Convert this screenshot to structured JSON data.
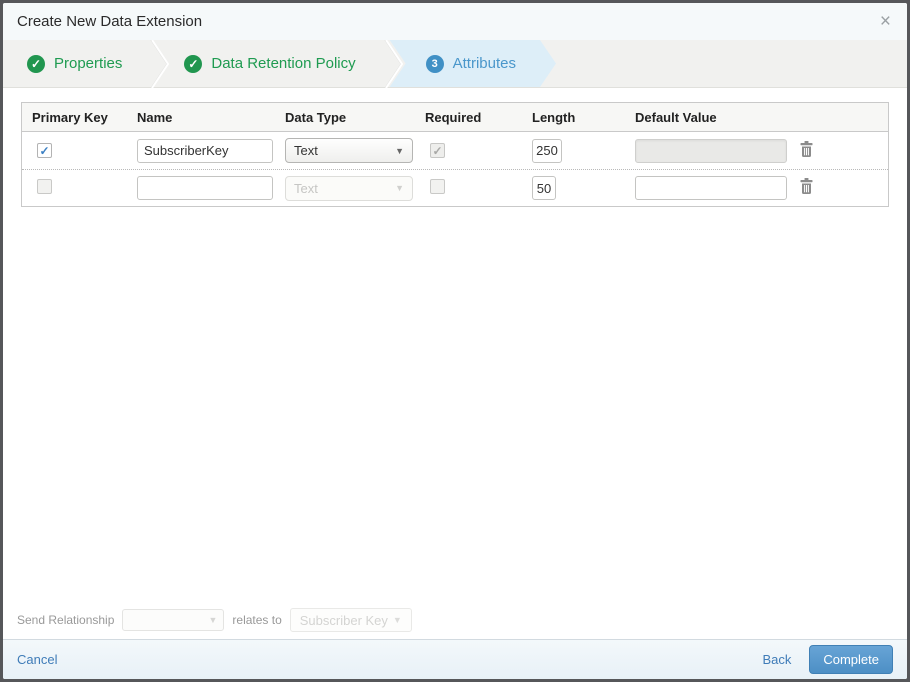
{
  "dialog": {
    "title": "Create New Data Extension"
  },
  "icons": {
    "close": "×",
    "check": "✓",
    "caret": "▼"
  },
  "steps": [
    {
      "label": "Properties",
      "status": "complete"
    },
    {
      "label": "Data Retention Policy",
      "status": "complete"
    },
    {
      "label": "Attributes",
      "status": "current",
      "number": "3"
    }
  ],
  "table": {
    "headers": {
      "primary_key": "Primary Key",
      "name": "Name",
      "data_type": "Data Type",
      "required": "Required",
      "length": "Length",
      "default_value": "Default Value"
    },
    "rows": [
      {
        "primary_key": true,
        "name": "SubscriberKey",
        "data_type": "Text",
        "data_type_enabled": true,
        "required": true,
        "required_enabled": false,
        "length": "250",
        "default_value": "",
        "default_value_enabled": false
      },
      {
        "primary_key": false,
        "name": "",
        "data_type": "Text",
        "data_type_enabled": false,
        "required": false,
        "required_enabled": true,
        "length": "50",
        "default_value": "",
        "default_value_enabled": true
      }
    ]
  },
  "send_relationship": {
    "label": "Send Relationship",
    "relates_label": "relates to",
    "target_value": "Subscriber Key"
  },
  "footer": {
    "cancel": "Cancel",
    "back": "Back",
    "complete": "Complete"
  },
  "colors": {
    "step_complete_green": "#21964f",
    "step_current_blue": "#4090c5",
    "step_current_bg": "#ddeef8",
    "link_blue": "#3f7cb8",
    "complete_button_blue": "#4d8fc5",
    "dialog_border": "#56575a"
  }
}
